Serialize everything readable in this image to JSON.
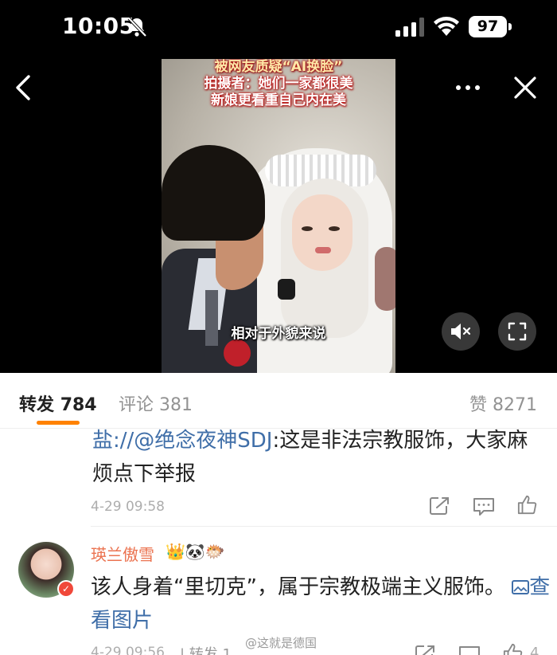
{
  "status_bar": {
    "time": "10:05",
    "battery": "97"
  },
  "video": {
    "caption_lines": [
      "被网友质疑“AI换脸”",
      "拍摄者：她们一家都很美",
      "新娘更看重自己内在美"
    ],
    "subtitle": "相对于外貌来说"
  },
  "tabs": {
    "repost_label": "转发",
    "repost_count": "784",
    "comment_label": "评论",
    "comment_count": "381",
    "like_label": "赞",
    "like_count": "8271"
  },
  "comment1": {
    "prefix": "盐://",
    "mention": "@绝念夜神SDJ",
    "body": ":这是非法宗教服饰，大家麻烦点下举报",
    "date": "4-29 09:58"
  },
  "comment2": {
    "username": "瑛兰傲雪",
    "badges": "👑🐼🐡",
    "body": "该人身着“里切克”，属于宗教极端主义服饰。",
    "image_link": "查看图片",
    "date": "4-29 09:56",
    "repost_label": "转发",
    "repost_count": "1",
    "like_count": "4"
  },
  "watermark": "@这就是德国",
  "colors": {
    "accent": "#ff8200",
    "link": "#3f6ea8",
    "username": "#eb7350"
  }
}
